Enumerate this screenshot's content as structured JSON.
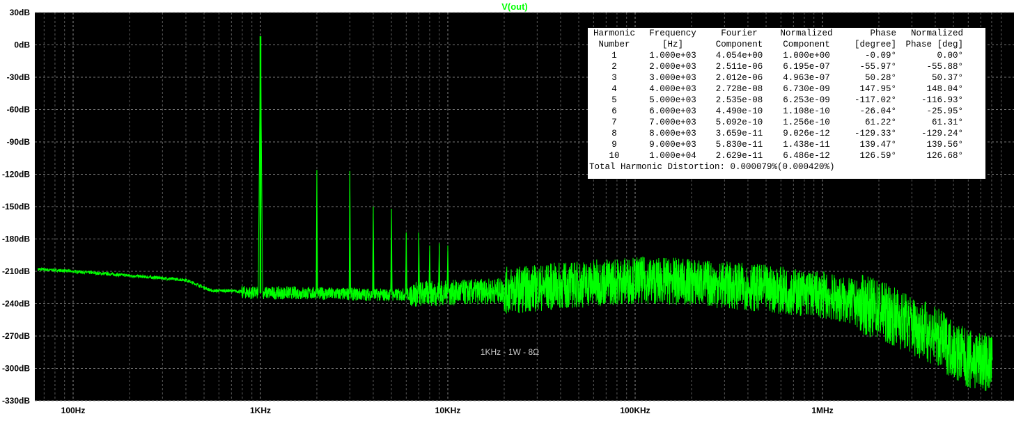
{
  "chart_data": {
    "type": "line",
    "title": "V(out)",
    "annotation": "1KHz - 1W - 8Ω",
    "x_scale": "log",
    "xlim": [
      65,
      900000
    ],
    "ylim": [
      -330,
      30
    ],
    "grid": true,
    "y_ticks": [
      "30dB",
      "0dB",
      "-30dB",
      "-60dB",
      "-90dB",
      "-120dB",
      "-150dB",
      "-180dB",
      "-210dB",
      "-240dB",
      "-270dB",
      "-300dB",
      "-330dB"
    ],
    "y_tick_values": [
      30,
      0,
      -30,
      -60,
      -90,
      -120,
      -150,
      -180,
      -210,
      -240,
      -270,
      -300,
      -330
    ],
    "x_ticks": [
      "100Hz",
      "1KHz",
      "10KHz",
      "100KHz",
      "1MHz"
    ],
    "x_tick_values": [
      100,
      1000,
      10000,
      100000,
      1000000
    ],
    "series": [
      {
        "color": "#00ff00",
        "baseline": [
          [
            65,
            -208
          ],
          [
            100,
            -210
          ],
          [
            200,
            -214
          ],
          [
            400,
            -218
          ],
          [
            550,
            -228
          ],
          [
            700,
            -228
          ],
          [
            900,
            -230
          ],
          [
            1500,
            -230
          ],
          [
            5000,
            -232
          ],
          [
            10000,
            -230
          ],
          [
            20000,
            -228
          ],
          [
            50000,
            -222
          ],
          [
            100000,
            -218
          ],
          [
            200000,
            -220
          ],
          [
            500000,
            -226
          ],
          [
            1000000,
            -232
          ],
          [
            2000000,
            -245
          ],
          [
            4000000,
            -270
          ],
          [
            6000000,
            -292
          ],
          [
            8500000,
            -296
          ]
        ],
        "peaks": [
          [
            1000,
            8
          ],
          [
            2000,
            -116
          ],
          [
            3000,
            -117
          ],
          [
            4000,
            -150
          ],
          [
            5000,
            -152
          ],
          [
            6000,
            -174
          ],
          [
            7000,
            -174
          ],
          [
            8000,
            -186
          ],
          [
            9000,
            -184
          ],
          [
            10000,
            -186
          ]
        ]
      }
    ]
  },
  "fourier_table": {
    "header_row1": [
      "Harmonic",
      "Frequency",
      "Fourier",
      "Normalized",
      "Phase",
      "Normalized"
    ],
    "header_row2": [
      "Number",
      "[Hz]",
      "Component",
      "Component",
      "[degree]",
      "Phase [deg]"
    ],
    "rows": [
      [
        "1",
        "1.000e+03",
        "4.054e+00",
        "1.000e+00",
        "-0.09°",
        "0.00°"
      ],
      [
        "2",
        "2.000e+03",
        "2.511e-06",
        "6.195e-07",
        "-55.97°",
        "-55.88°"
      ],
      [
        "3",
        "3.000e+03",
        "2.012e-06",
        "4.963e-07",
        "50.28°",
        "50.37°"
      ],
      [
        "4",
        "4.000e+03",
        "2.728e-08",
        "6.730e-09",
        "147.95°",
        "148.04°"
      ],
      [
        "5",
        "5.000e+03",
        "2.535e-08",
        "6.253e-09",
        "-117.02°",
        "-116.93°"
      ],
      [
        "6",
        "6.000e+03",
        "4.490e-10",
        "1.108e-10",
        "-26.04°",
        "-25.95°"
      ],
      [
        "7",
        "7.000e+03",
        "5.092e-10",
        "1.256e-10",
        "61.22°",
        "61.31°"
      ],
      [
        "8",
        "8.000e+03",
        "3.659e-11",
        "9.026e-12",
        "-129.33°",
        "-129.24°"
      ],
      [
        "9",
        "9.000e+03",
        "5.830e-11",
        "1.438e-11",
        "139.47°",
        "139.56°"
      ],
      [
        "10",
        "1.000e+04",
        "2.629e-11",
        "6.486e-12",
        "126.59°",
        "126.68°"
      ]
    ],
    "thd": "Total Harmonic Distortion: 0.000079%(0.000420%)"
  }
}
